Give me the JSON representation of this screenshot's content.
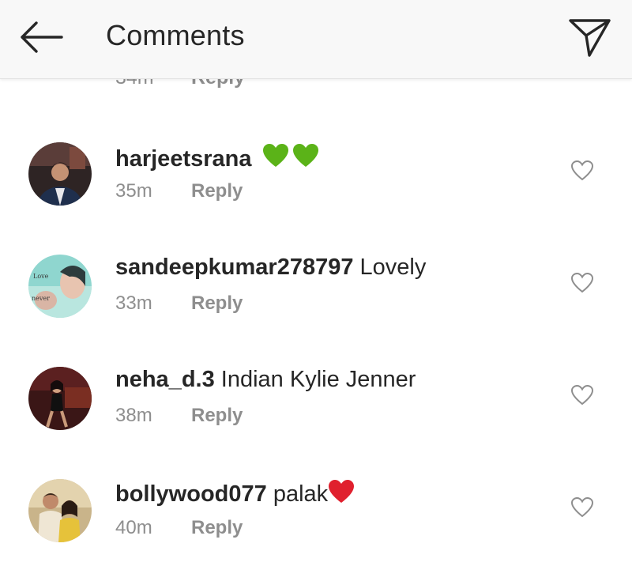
{
  "header": {
    "title": "Comments",
    "back_icon": "arrow-left-icon",
    "send_icon": "paper-plane-icon"
  },
  "partial_comment": {
    "time": "34m",
    "reply_label": "Reply"
  },
  "comments": [
    {
      "username": "harjeetsrana",
      "text": "",
      "emoji": "💚💚",
      "time": "35m",
      "reply_label": "Reply"
    },
    {
      "username": "sandeepkumar278797",
      "text": "Lovely",
      "emoji": "",
      "time": "33m",
      "reply_label": "Reply"
    },
    {
      "username": "neha_d.3",
      "text": "Indian Kylie Jenner",
      "emoji": "",
      "time": "38m",
      "reply_label": "Reply"
    },
    {
      "username": "bollywood077",
      "text": "palak",
      "emoji": "❤️",
      "time": "40m",
      "reply_label": "Reply"
    }
  ],
  "colors": {
    "header_bg": "#f8f8f8",
    "text_primary": "#262626",
    "text_secondary": "#8e8e8e",
    "green_heart": "#5bb318",
    "red_heart": "#e0202e"
  }
}
